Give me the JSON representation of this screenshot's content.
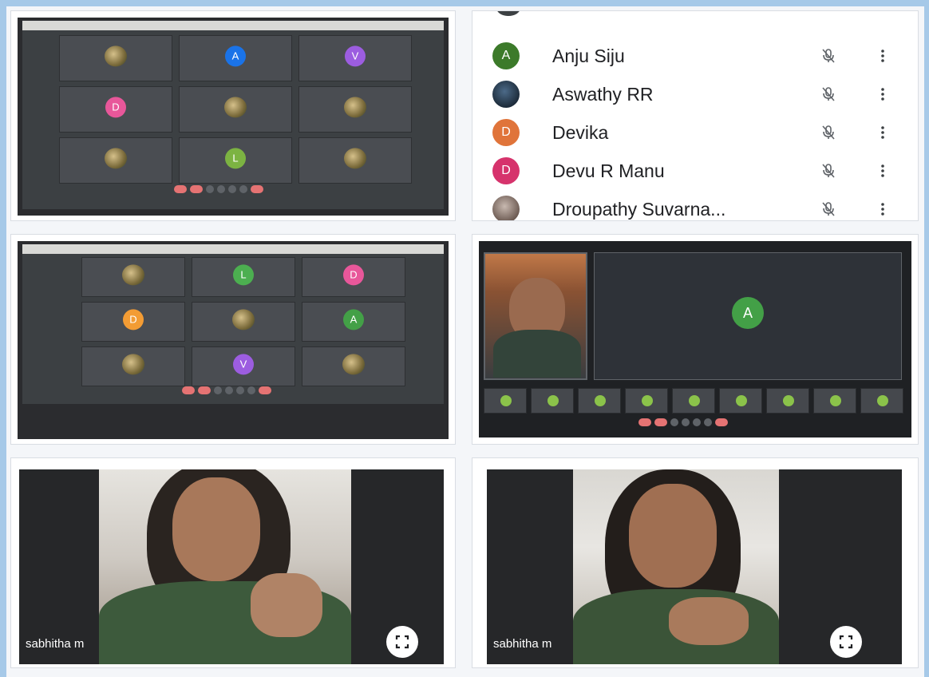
{
  "participants": {
    "items": [
      {
        "name": "Anju Siju",
        "initial": "A",
        "color": "#3c7a2a",
        "avatar": "letter"
      },
      {
        "name": "Aswathy RR",
        "initial": "",
        "color": "#2c3e50",
        "avatar": "photo"
      },
      {
        "name": "Devika",
        "initial": "D",
        "color": "#e0743a",
        "avatar": "letter"
      },
      {
        "name": "Devu R Manu",
        "initial": "D",
        "color": "#d6336c",
        "avatar": "letter"
      },
      {
        "name": "Droupathy Suvarna...",
        "initial": "",
        "color": "#8a7a70",
        "avatar": "photo"
      }
    ]
  },
  "meet_grid_1": {
    "tiles": [
      {
        "type": "photo"
      },
      {
        "type": "letter",
        "initial": "A",
        "color": "#1a73e8"
      },
      {
        "type": "letter",
        "initial": "V",
        "color": "#9c5de0"
      },
      {
        "type": "letter",
        "initial": "D",
        "color": "#e8579a"
      },
      {
        "type": "photo"
      },
      {
        "type": "photo"
      },
      {
        "type": "photo"
      },
      {
        "type": "letter",
        "initial": "L",
        "color": "#7cb342"
      },
      {
        "type": "photo"
      }
    ]
  },
  "meet_grid_2": {
    "tiles": [
      {
        "type": "photo"
      },
      {
        "type": "letter",
        "initial": "L",
        "color": "#4caf50"
      },
      {
        "type": "letter",
        "initial": "D",
        "color": "#e8579a"
      },
      {
        "type": "letter",
        "initial": "D",
        "color": "#f39c34"
      },
      {
        "type": "photo"
      },
      {
        "type": "letter",
        "initial": "A",
        "color": "#43a047"
      },
      {
        "type": "photo"
      },
      {
        "type": "letter",
        "initial": "V",
        "color": "#9c5de0"
      },
      {
        "type": "photo"
      }
    ]
  },
  "meet_spotlight": {
    "main_initial": "A",
    "main_color": "#43a047"
  },
  "video_left": {
    "name": "sabhitha m"
  },
  "video_right": {
    "name": "sabhitha m"
  }
}
